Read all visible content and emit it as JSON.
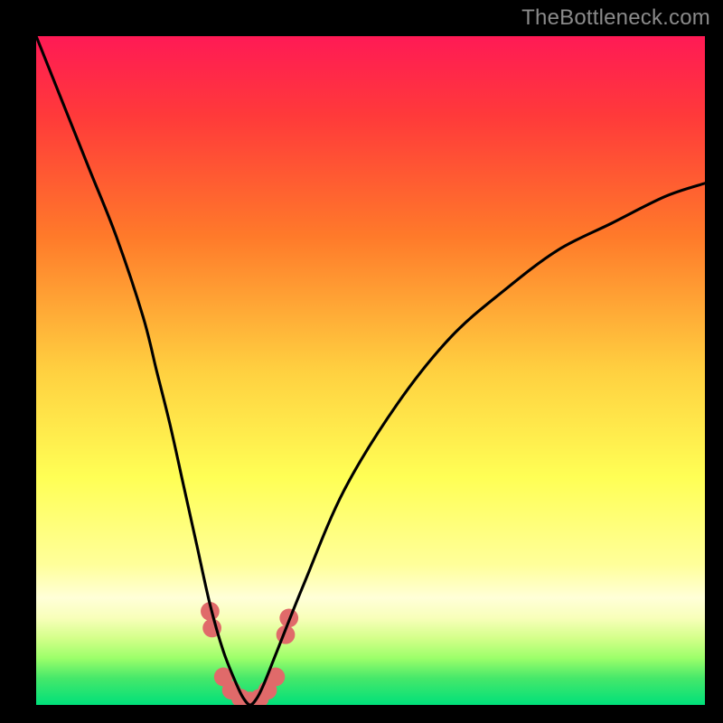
{
  "watermark": "TheBottleneck.com",
  "chart_data": {
    "type": "line",
    "title": "",
    "xlabel": "",
    "ylabel": "",
    "xlim": [
      0,
      100
    ],
    "ylim": [
      0,
      100
    ],
    "gradient_stops": [
      {
        "pct": 0,
        "color": "#ff1a55"
      },
      {
        "pct": 12,
        "color": "#ff3a3a"
      },
      {
        "pct": 30,
        "color": "#ff7a2a"
      },
      {
        "pct": 50,
        "color": "#ffd040"
      },
      {
        "pct": 66,
        "color": "#ffff55"
      },
      {
        "pct": 79,
        "color": "#ffff9a"
      },
      {
        "pct": 84,
        "color": "#ffffd8"
      },
      {
        "pct": 87,
        "color": "#f8ffba"
      },
      {
        "pct": 90,
        "color": "#d4ff8a"
      },
      {
        "pct": 93,
        "color": "#9cff6a"
      },
      {
        "pct": 96,
        "color": "#46e86a"
      },
      {
        "pct": 100,
        "color": "#00e07a"
      }
    ],
    "series": [
      {
        "name": "bottleneck-curve",
        "color": "#000000",
        "x": [
          0,
          4,
          8,
          12,
          16,
          18,
          20,
          22,
          24,
          26,
          28,
          30,
          31,
          32,
          33,
          34,
          36,
          40,
          46,
          54,
          62,
          70,
          78,
          86,
          94,
          100
        ],
        "y": [
          100,
          90,
          80,
          70,
          58,
          50,
          42,
          33,
          24,
          15,
          8,
          3,
          1,
          0,
          1,
          3,
          8,
          18,
          32,
          45,
          55,
          62,
          68,
          72,
          76,
          78
        ]
      }
    ],
    "markers": {
      "name": "highlight-dots",
      "color": "#e06a6a",
      "radius": 1.4,
      "points": [
        {
          "x": 26.0,
          "y": 14.0
        },
        {
          "x": 26.3,
          "y": 11.5
        },
        {
          "x": 28.0,
          "y": 4.2
        },
        {
          "x": 29.2,
          "y": 2.2
        },
        {
          "x": 30.6,
          "y": 1.0
        },
        {
          "x": 32.0,
          "y": 0.6
        },
        {
          "x": 33.4,
          "y": 1.0
        },
        {
          "x": 34.6,
          "y": 2.2
        },
        {
          "x": 35.8,
          "y": 4.2
        },
        {
          "x": 37.3,
          "y": 10.5
        },
        {
          "x": 37.8,
          "y": 13.0
        }
      ]
    }
  }
}
